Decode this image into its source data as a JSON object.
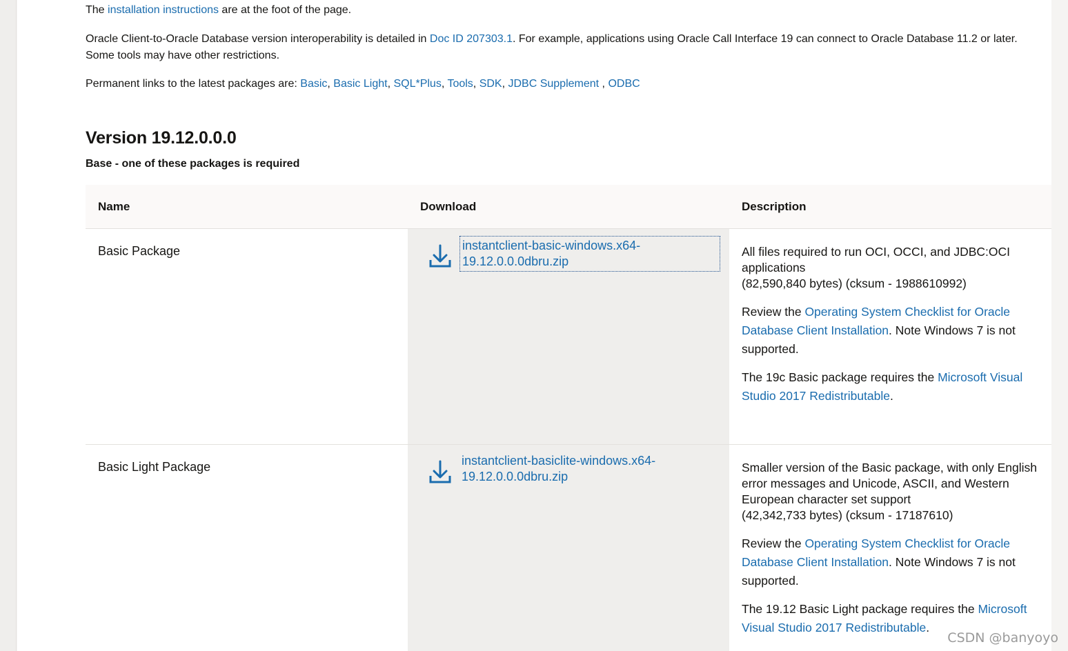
{
  "intro": {
    "prefix": "The ",
    "link": "installation instructions",
    "suffix": " are at the foot of the page."
  },
  "interop": {
    "prefix": "Oracle Client-to-Oracle Database version interoperability is detailed in ",
    "link": "Doc ID 207303.1",
    "suffix": ". For example, applications using Oracle Call Interface 19 can connect to Oracle Database 11.2 or later. Some tools may have other restrictions."
  },
  "permalinks": {
    "prefix": "Permanent links to the latest packages are: ",
    "links": [
      "Basic",
      "Basic Light",
      "SQL*Plus",
      "Tools",
      "SDK",
      "JDBC Supplement",
      "ODBC"
    ]
  },
  "version_title": "Version 19.12.0.0.0",
  "base_note": "Base - one of these packages is required",
  "table": {
    "headers": [
      "Name",
      "Download",
      "Description"
    ],
    "rows": [
      {
        "name": "Basic Package",
        "download": "instantclient-basic-windows.x64-19.12.0.0.0dbru.zip",
        "desc_main": "All files required to run OCI, OCCI, and JDBC:OCI applications",
        "desc_size": "(82,590,840 bytes) (cksum - 1988610992)",
        "review_prefix": "Review the ",
        "review_link": "Operating System Checklist for Oracle Database Client Installation",
        "review_suffix": ". Note Windows 7 is not supported.",
        "req_prefix": "The 19c Basic package requires the ",
        "req_link": "Microsoft Visual Studio 2017 Redistributable",
        "req_suffix": "."
      },
      {
        "name": "Basic Light Package",
        "download": "instantclient-basiclite-windows.x64-19.12.0.0.0dbru.zip",
        "desc_main": "Smaller version of the Basic package, with only English error messages and Unicode, ASCII, and Western European character set support",
        "desc_size": "(42,342,733 bytes) (cksum - 17187610)",
        "review_prefix": "Review the ",
        "review_link": "Operating System Checklist for Oracle Database Client Installation",
        "review_suffix": ". Note Windows 7 is not supported.",
        "req_prefix": "The 19.12 Basic Light package requires the ",
        "req_link": "Microsoft Visual Studio 2017 Redistributable",
        "req_suffix": "."
      }
    ]
  },
  "watermark": "CSDN @banyoyo",
  "colors": {
    "link": "#1a6cae",
    "download_bg": "#efeeec",
    "icon": "#1a6cae"
  },
  "icons": {
    "download": "download-icon"
  }
}
